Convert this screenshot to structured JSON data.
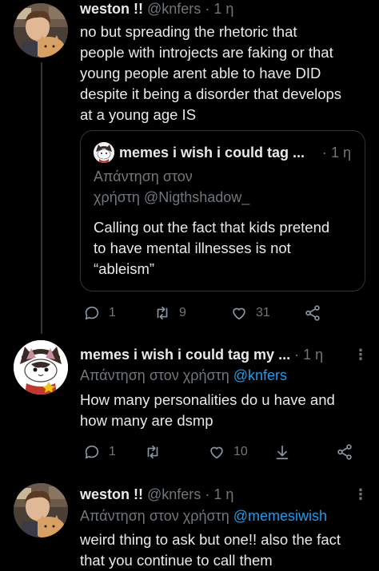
{
  "tweets": [
    {
      "name": "weston !!",
      "handle": "@knfers",
      "dot": "·",
      "time": "1 η",
      "text": "no but spreading the rhetoric that\npeople with introjects are faking or that\nyoung people arent able to have DID\ndespite it being a disorder that develops\nat a young age IS",
      "quote": {
        "name": "memes i wish i could tag ...",
        "dot": "·",
        "time": "1 η",
        "reply_line": "Απάντηση στον\nχρήστη @Nigthshadow_",
        "text": "Calling out the fact that kids pretend\nto have mental illnesses is not\n“ableism”"
      },
      "replies": "1",
      "retweets": "9",
      "likes": "31"
    },
    {
      "name": "memes i wish i could tag my ...",
      "dot": "·",
      "time": "1 η",
      "more": "⋮",
      "reply_prefix": "Απάντηση στον χρήστη",
      "reply_mention": "@knfers",
      "text": "How many personalities do u have and\nhow many are dsmp",
      "replies": "1",
      "likes": "10"
    },
    {
      "name": "weston !!",
      "handle": "@knfers",
      "dot": "·",
      "time": "1 η",
      "more": "⋮",
      "reply_prefix": "Απάντηση στον χρήστη",
      "reply_mention": "@memesiwish",
      "text": "weird thing to ask but one!! also the fact\nthat you continue to call them"
    }
  ],
  "colors": {
    "background": "#000000",
    "text": "#e7e9ea",
    "muted": "#71767b",
    "accent": "#1d9bf0",
    "border": "#2f3336"
  },
  "icons": [
    "reply-icon",
    "retweet-icon",
    "like-icon",
    "share-icon",
    "download-icon",
    "more-icon"
  ]
}
